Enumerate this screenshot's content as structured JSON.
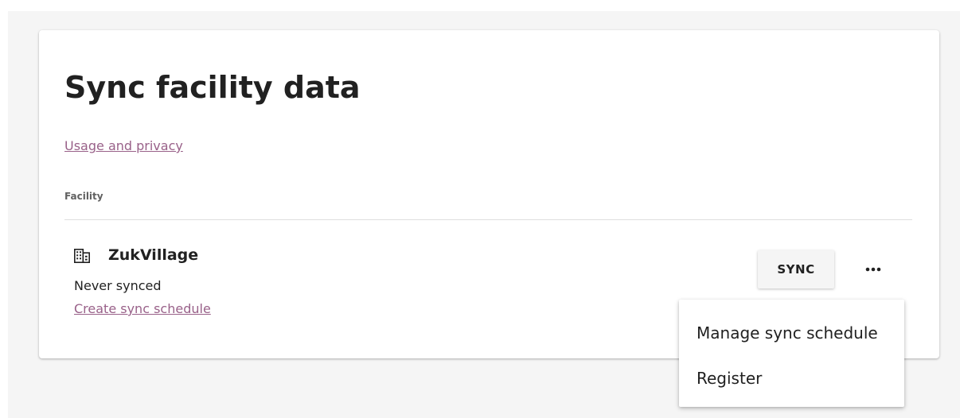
{
  "page": {
    "title": "Sync facility data",
    "privacy_link": "Usage and privacy"
  },
  "table": {
    "column_header": "Facility"
  },
  "facility": {
    "icon": "facility-building-icon",
    "name": "ZukVillage",
    "status": "Never synced",
    "schedule_link": "Create sync schedule"
  },
  "actions": {
    "sync_label": "SYNC",
    "more_icon": "more-horizontal-icon"
  },
  "menu": {
    "items": [
      {
        "label": "Manage sync schedule"
      },
      {
        "label": "Register"
      }
    ]
  },
  "colors": {
    "link": "#996189",
    "background": "#f5f5f5",
    "card": "#ffffff",
    "text": "#212121"
  }
}
